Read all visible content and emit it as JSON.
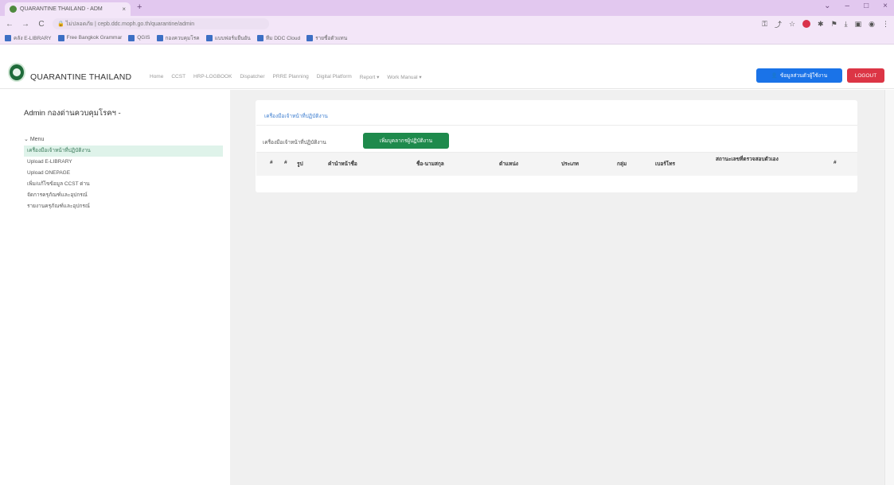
{
  "browser": {
    "tab_title": "QUARANTINE THAILAND - ADM",
    "tab_close": "×",
    "new_tab": "+",
    "window_controls": [
      "⌄",
      "–",
      "□",
      "×"
    ],
    "url": "🔒 ไม่ปลอดภัย | cepb.ddc.moph.go.th/quarantine/admin",
    "nav": [
      "←",
      "→",
      "C"
    ],
    "bookmarks": [
      "คลัง E-LIBRARY",
      "Free Bangkok Grammar",
      "QGIS",
      "กองควบคุมโรค",
      "แบบฟอร์มยืนยัน",
      "ทีม DDC Cloud",
      "รายชื่อตัวแทน"
    ]
  },
  "app": {
    "brand": "QUARANTINE THAILAND",
    "menu": [
      "Home",
      "CCST",
      "HRP-LOGBOOK",
      "Dispatcher",
      "PRRE Planning",
      "Digital Platform",
      "Report ▾",
      "Work Manual ▾"
    ],
    "user_button": "ข้อมูลส่วนตัวผู้ใช้งาน",
    "logout_button": "LOGOUT",
    "brand_color": "#1f6b3a",
    "primary_color": "#1a73e8",
    "danger_color": "#dc3545",
    "success_color": "#1e8a4c"
  },
  "sidebar": {
    "title": "Admin กองด่านควบคุมโรคฯ -",
    "menu_label": "Menu",
    "items": [
      {
        "label": "เครื่องมือเจ้าหน้าที่ปฏิบัติงาน",
        "active": true
      },
      {
        "label": "Upload E-LIBRARY",
        "active": false
      },
      {
        "label": "Upload ONEPAGE",
        "active": false
      },
      {
        "label": "เพิ่ม/แก้ไขข้อมูล CCST ด่าน",
        "active": false
      },
      {
        "label": "จัดการครุภัณฑ์และอุปกรณ์",
        "active": false
      },
      {
        "label": "รายงานครุภัณฑ์และอุปกรณ์",
        "active": false
      }
    ]
  },
  "main": {
    "card_link": "เครื่องมือเจ้าหน้าที่ปฏิบัติงาน",
    "card_sub": "เครื่องมือเจ้าหน้าที่ปฏิบัติงาน",
    "add_button": "เพิ่มบุคลากรผู้ปฏิบัติงาน",
    "columns": [
      "#",
      "#",
      "รูป",
      "คำนำหน้าชื่อ",
      "ชื่อ-นามสกุล",
      "ตำแหน่ง",
      "ประเภท",
      "กลุ่ม",
      "เบอร์โทร",
      "สถานะเลขที่ตรวจสอบตัวเอง",
      "#"
    ]
  }
}
